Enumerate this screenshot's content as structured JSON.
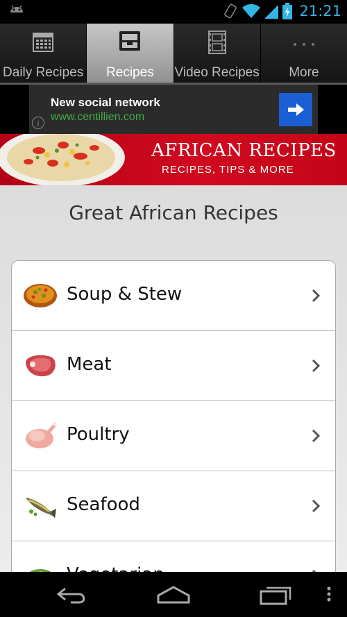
{
  "status_bar": {
    "time": "21:21"
  },
  "tabs": [
    {
      "label": "Daily Recipes",
      "icon": "calendar-icon",
      "active": false
    },
    {
      "label": "Recipes",
      "icon": "inbox-tray-icon",
      "active": true
    },
    {
      "label": "Video Recipes",
      "icon": "film-strip-icon",
      "active": false
    },
    {
      "label": "More",
      "icon": "more-dots-icon",
      "active": false
    }
  ],
  "ad": {
    "title": "New social network",
    "url": "www.centillien.com",
    "info": "i"
  },
  "banner": {
    "title": "AFRICAN RECIPES",
    "subtitle": "RECIPES, TIPS & MORE"
  },
  "heading": "Great African Recipes",
  "categories": [
    {
      "label": "Soup & Stew",
      "icon": "soup-bowl-icon"
    },
    {
      "label": "Meat",
      "icon": "meat-icon"
    },
    {
      "label": "Poultry",
      "icon": "chicken-icon"
    },
    {
      "label": "Seafood",
      "icon": "fish-icon"
    },
    {
      "label": "Vegetarian",
      "icon": "salad-icon"
    }
  ],
  "colors": {
    "accent": "#33b5e5",
    "banner_red": "#c8081b",
    "ad_green": "#3fae3f",
    "ad_button": "#1a5fd6"
  }
}
